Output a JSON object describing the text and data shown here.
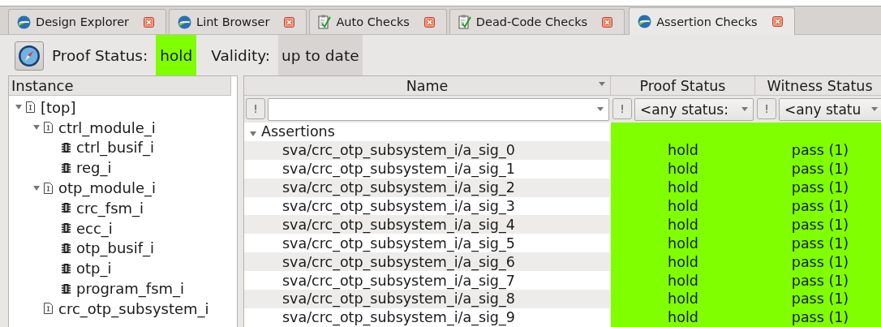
{
  "tabs": [
    {
      "label": "Design Explorer",
      "kind": "sphere",
      "selected": false
    },
    {
      "label": "Lint Browser",
      "kind": "sphere",
      "selected": false
    },
    {
      "label": "Auto Checks",
      "kind": "checklist",
      "selected": false
    },
    {
      "label": "Dead-Code Checks",
      "kind": "checklist",
      "selected": false
    },
    {
      "label": "Assertion Checks",
      "kind": "sphere",
      "selected": true
    }
  ],
  "toolbar": {
    "proof_status_label": "Proof Status:",
    "proof_status": "hold",
    "validity_label": "Validity:",
    "validity": "up to date"
  },
  "instance_tree": {
    "header": "Instance",
    "items": [
      {
        "label": "[top]",
        "kind": "module",
        "expanded": true,
        "children": [
          {
            "label": "ctrl_module_i",
            "kind": "module",
            "expanded": true,
            "children": [
              {
                "label": "ctrl_busif_i",
                "kind": "instance"
              },
              {
                "label": "reg_i",
                "kind": "instance"
              }
            ]
          },
          {
            "label": "otp_module_i",
            "kind": "module",
            "expanded": true,
            "children": [
              {
                "label": "crc_fsm_i",
                "kind": "instance"
              },
              {
                "label": "ecc_i",
                "kind": "instance"
              },
              {
                "label": "otp_busif_i",
                "kind": "instance"
              },
              {
                "label": "otp_i",
                "kind": "instance"
              },
              {
                "label": "program_fsm_i",
                "kind": "instance"
              }
            ]
          },
          {
            "label": "crc_otp_subsystem_i",
            "kind": "module"
          }
        ]
      }
    ]
  },
  "table": {
    "columns": [
      "Name",
      "Proof Status",
      "Witness Status"
    ],
    "filters": [
      {
        "mark": "!"
      },
      {
        "mark": "!",
        "value": "<any status:"
      },
      {
        "mark": "!",
        "value": "<any statu"
      }
    ],
    "group": {
      "label": "Assertions",
      "expanded": true
    },
    "rows": [
      {
        "name": "sva/crc_otp_subsystem_i/a_sig_0",
        "proof": "hold",
        "witness": "pass (1)"
      },
      {
        "name": "sva/crc_otp_subsystem_i/a_sig_1",
        "proof": "hold",
        "witness": "pass (1)"
      },
      {
        "name": "sva/crc_otp_subsystem_i/a_sig_2",
        "proof": "hold",
        "witness": "pass (1)"
      },
      {
        "name": "sva/crc_otp_subsystem_i/a_sig_3",
        "proof": "hold",
        "witness": "pass (1)"
      },
      {
        "name": "sva/crc_otp_subsystem_i/a_sig_4",
        "proof": "hold",
        "witness": "pass (1)"
      },
      {
        "name": "sva/crc_otp_subsystem_i/a_sig_5",
        "proof": "hold",
        "witness": "pass (1)"
      },
      {
        "name": "sva/crc_otp_subsystem_i/a_sig_6",
        "proof": "hold",
        "witness": "pass (1)"
      },
      {
        "name": "sva/crc_otp_subsystem_i/a_sig_7",
        "proof": "hold",
        "witness": "pass (1)"
      },
      {
        "name": "sva/crc_otp_subsystem_i/a_sig_8",
        "proof": "hold",
        "witness": "pass (1)"
      },
      {
        "name": "sva/crc_otp_subsystem_i/a_sig_9",
        "proof": "hold",
        "witness": "pass (1)"
      }
    ]
  }
}
